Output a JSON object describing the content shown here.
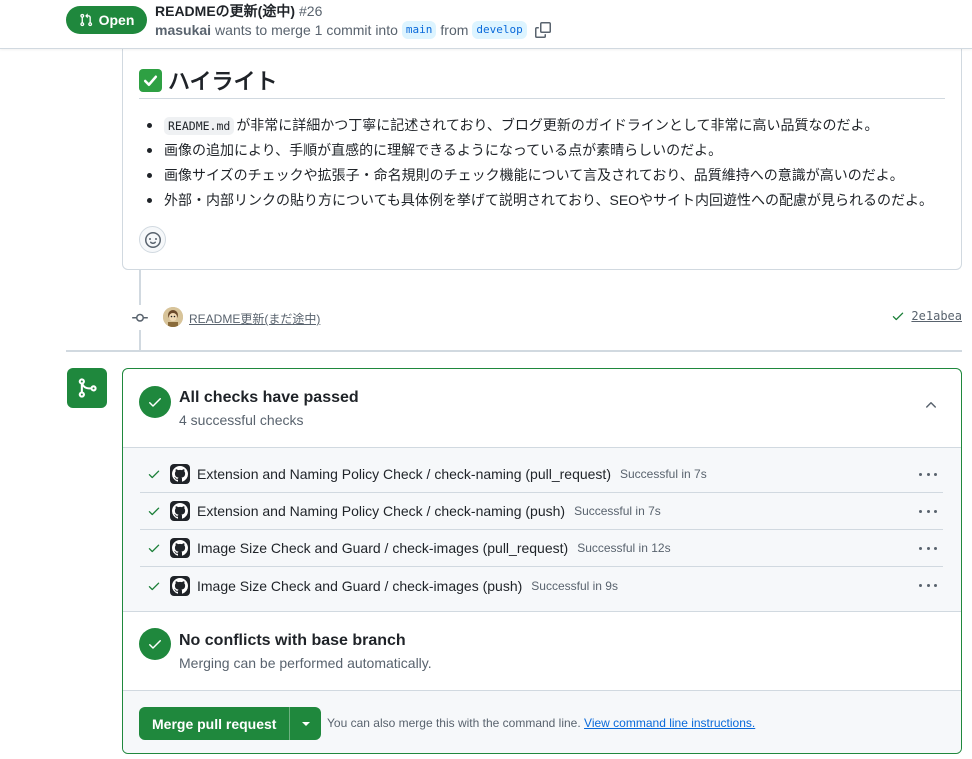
{
  "header": {
    "state": "Open",
    "title": "READMEの更新(途中)",
    "number": "#26",
    "author": "masukai",
    "merge_text": "wants to merge 1 commit into",
    "base_branch": "main",
    "from_text": "from",
    "head_branch": "develop"
  },
  "comment": {
    "heading_emoji": "check-mark-button",
    "heading": "ハイライト",
    "items": [
      {
        "code": "README.md",
        "text": "が非常に詳細かつ丁寧に記述されており、ブログ更新のガイドラインとして非常に高い品質なのだよ。"
      },
      {
        "text": "画像の追加により、手順が直感的に理解できるようになっている点が素晴らしいのだよ。"
      },
      {
        "text": "画像サイズのチェックや拡張子・命名規則のチェック機能について言及されており、品質維持への意識が高いのだよ。"
      },
      {
        "text": "外部・内部リンクの貼り方についても具体例を挙げて説明されており、SEOやサイト内回遊性への配慮が見られるのだよ。"
      }
    ]
  },
  "commit": {
    "message": "README更新(まだ途中)",
    "sha": "2e1abea"
  },
  "checks": {
    "title": "All checks have passed",
    "subtitle": "4 successful checks",
    "items": [
      {
        "name": "Extension and Naming Policy Check / check-naming (pull_request)",
        "status": "Successful in 7s"
      },
      {
        "name": "Extension and Naming Policy Check / check-naming (push)",
        "status": "Successful in 7s"
      },
      {
        "name": "Image Size Check and Guard / check-images (pull_request)",
        "status": "Successful in 12s"
      },
      {
        "name": "Image Size Check and Guard / check-images (push)",
        "status": "Successful in 9s"
      }
    ]
  },
  "conflicts": {
    "title": "No conflicts with base branch",
    "subtitle": "Merging can be performed automatically."
  },
  "merge": {
    "button_label": "Merge pull request",
    "note": "You can also merge this with the command line.",
    "link": "View command line instructions."
  },
  "colors": {
    "success": "#1f883d",
    "accent": "#0969da",
    "muted": "#59636e"
  }
}
